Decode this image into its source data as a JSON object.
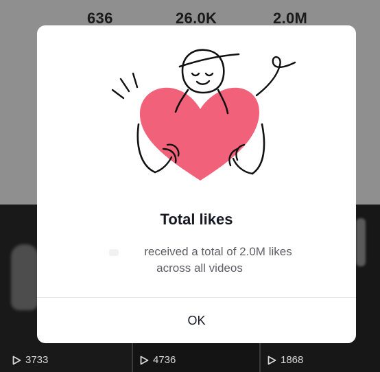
{
  "profile_stats": {
    "following": "636",
    "followers": "26.0K",
    "likes": "2.0M"
  },
  "videos": [
    {
      "plays": "3733"
    },
    {
      "plays": "4736"
    },
    {
      "plays": "1868"
    }
  ],
  "modal": {
    "illustration_icon": "person-hugging-heart-icon",
    "title": "Total likes",
    "message_line_1": "received a total of 2.0M likes",
    "message_line_2": "across all videos",
    "ok_label": "OK"
  },
  "colors": {
    "heart": "#f2617a",
    "text_primary": "#161823",
    "text_secondary": "#5e5f66"
  }
}
